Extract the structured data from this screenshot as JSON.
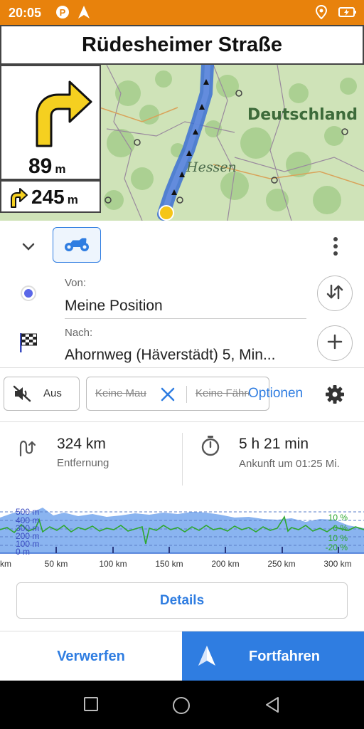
{
  "status_bar": {
    "time": "20:05",
    "left_icons": [
      "parking-icon",
      "navigation-arrow-icon"
    ],
    "right_icons": [
      "location-pin-icon",
      "battery-icon"
    ],
    "background": "#e8820c"
  },
  "navigation": {
    "street_name": "Rüdesheimer Straße",
    "turn": {
      "icon": "turn-right-arrow-icon",
      "distance": "89",
      "unit": "m"
    },
    "next_turn": {
      "icon": "turn-right-small-icon",
      "distance": "245",
      "unit": "m"
    }
  },
  "map": {
    "country_label": "Deutschland",
    "region_label": "Hessen",
    "route_color": "#3b6fd4"
  },
  "route_panel": {
    "profile_icon": "motorcycle-icon",
    "from_label": "Von:",
    "from_value": "Meine Position",
    "to_label": "Nach:",
    "to_value": "Ahornweg (Häverstädt) 5, Min...",
    "swap_icon": "swap-icon",
    "add_icon": "plus-icon"
  },
  "options": {
    "sound_label": "Aus",
    "avoid_toll": "Keine Maut",
    "avoid_ferries": "Keine Fähren",
    "options_label": "Optionen"
  },
  "stats": {
    "distance_value": "324 km",
    "distance_label": "Entfernung",
    "time_value": "5 h 21 min",
    "arrival_label": "Ankunft um 01:25 Mi."
  },
  "elevation_chart": {
    "type": "area",
    "y_left_labels": [
      "500 m",
      "400 m",
      "300 m",
      "200 m",
      "100 m",
      "0 m"
    ],
    "y_right_labels": [
      "10 %",
      "0 %",
      "10 %",
      "-20 %"
    ],
    "x_labels": [
      "km",
      "50 km",
      "100 km",
      "150 km",
      "200 km",
      "250 km",
      "300 km"
    ],
    "fill_color": "#8ab4f0",
    "slope_color": "#2ea82e"
  },
  "buttons": {
    "details": "Details",
    "discard": "Verwerfen",
    "continue": "Fortfahren"
  },
  "accent_color": "#2f7de1"
}
